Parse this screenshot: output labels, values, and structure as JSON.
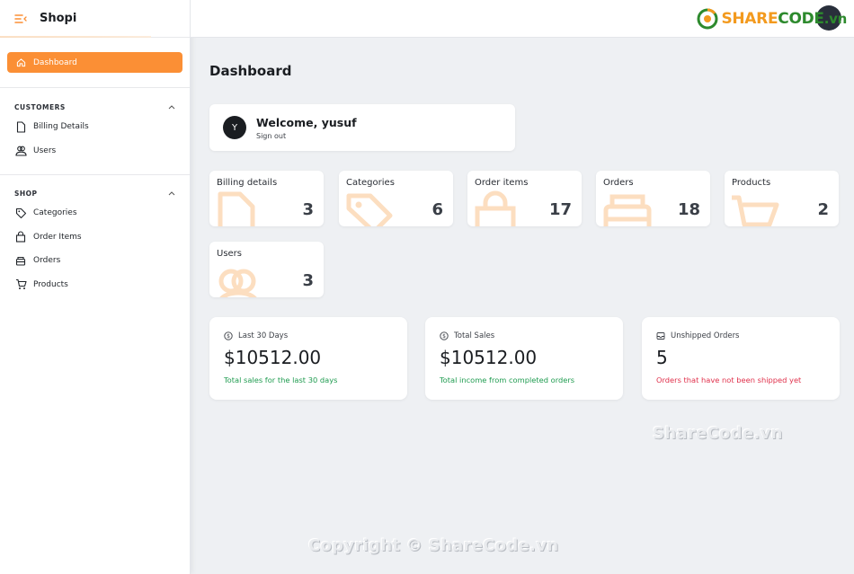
{
  "app": {
    "title": "Shopi"
  },
  "sidebar": {
    "active": {
      "label": "Dashboard",
      "icon": "home-icon",
      "color": "#fb8f35"
    },
    "sections": [
      {
        "title": "CUSTOMERS",
        "items": [
          {
            "label": "Billing Details",
            "icon": "file-icon"
          },
          {
            "label": "Users",
            "icon": "users-icon"
          }
        ]
      },
      {
        "title": "SHOP",
        "items": [
          {
            "label": "Categories",
            "icon": "tag-icon"
          },
          {
            "label": "Order Items",
            "icon": "bag-icon"
          },
          {
            "label": "Orders",
            "icon": "box-icon"
          },
          {
            "label": "Products",
            "icon": "cart-icon"
          }
        ]
      }
    ]
  },
  "topbar": {
    "logo": {
      "share": "SHARE",
      "code": "CODE",
      "vn": ".vn"
    }
  },
  "main": {
    "title": "Dashboard",
    "welcome": {
      "avatar": "Y",
      "greeting": "Welcome, yusuf",
      "signout": "Sign out"
    },
    "stats": [
      {
        "label": "Billing details",
        "value": "3",
        "icon": "file-icon"
      },
      {
        "label": "Categories",
        "value": "6",
        "icon": "tag-icon"
      },
      {
        "label": "Order items",
        "value": "17",
        "icon": "bag-icon"
      },
      {
        "label": "Orders",
        "value": "18",
        "icon": "box-icon"
      },
      {
        "label": "Products",
        "value": "2",
        "icon": "cart-icon"
      },
      {
        "label": "Users",
        "value": "3",
        "icon": "users-icon"
      }
    ],
    "cards": [
      {
        "label": "Last 30 Days",
        "value": "$10512.00",
        "note": "Total sales for the last 30 days",
        "icon": "dollar-icon",
        "note_color": "#1e9b4f"
      },
      {
        "label": "Total Sales",
        "value": "$10512.00",
        "note": "Total income from completed orders",
        "icon": "dollar-icon",
        "note_color": "#1e9b4f"
      },
      {
        "label": "Unshipped Orders",
        "value": "5",
        "note": "Orders that have not been shipped yet",
        "icon": "inbox-icon",
        "note_color": "#e0304b"
      }
    ]
  },
  "watermarks": {
    "center": "ShareCode.vn",
    "bottom": "Copyright © ShareCode.vn"
  }
}
